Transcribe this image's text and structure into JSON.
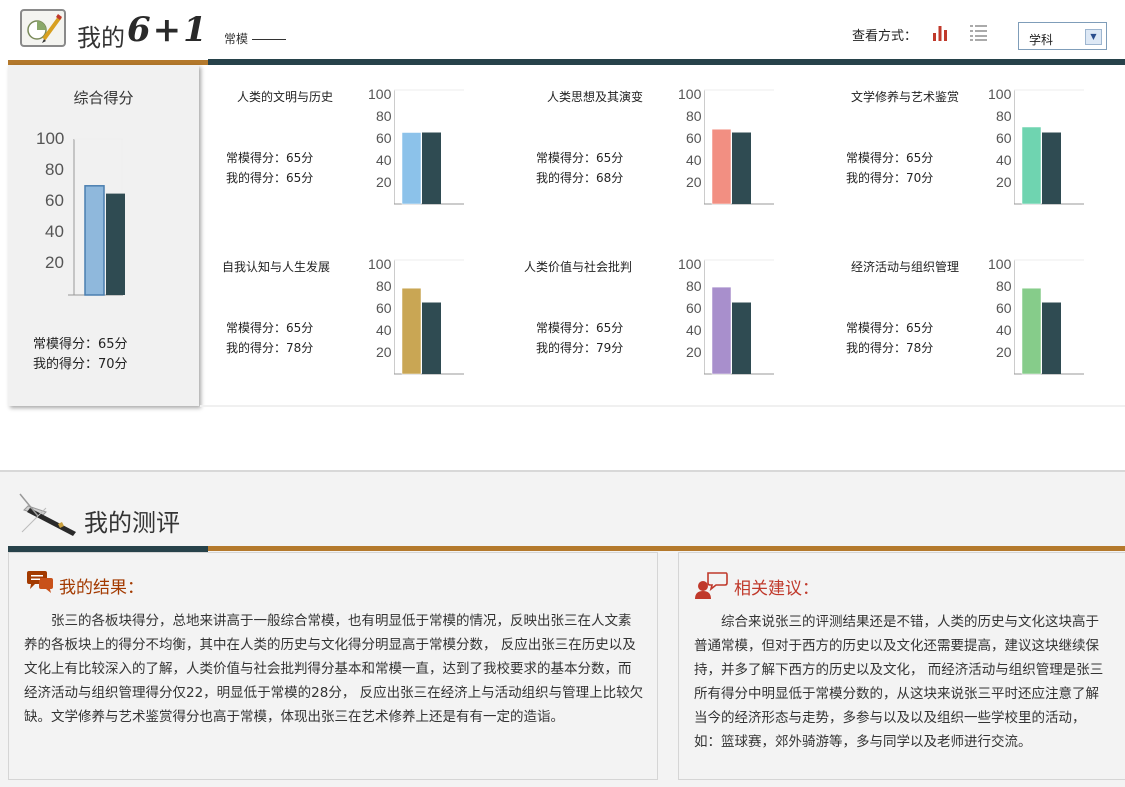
{
  "header": {
    "title_cn": "我的",
    "title_num": "6+1",
    "legend_label": "常模",
    "view_mode_label": "查看方式：",
    "subject_select_value": "学科"
  },
  "summary": {
    "title": "综合得分",
    "norm_score_text": "常模得分：65分",
    "my_score_text": "我的得分：70分",
    "ticks": [
      "100",
      "80",
      "60",
      "40",
      "20"
    ],
    "chart": {
      "my": 70,
      "norm": 65,
      "my_color": "#8fb8dc"
    }
  },
  "subjects": [
    {
      "title": "人类的文明与历史",
      "norm_text": "常模得分：65分",
      "my_text": "我的得分：65分",
      "my": 65,
      "norm": 65,
      "color": "#8cc2ea"
    },
    {
      "title": "人类思想及其演变",
      "norm_text": "常模得分：65分",
      "my_text": "我的得分：68分",
      "my": 68,
      "norm": 65,
      "color": "#f28f82"
    },
    {
      "title": "文学修养与艺术鉴赏",
      "norm_text": "常模得分：65分",
      "my_text": "我的得分：70分",
      "my": 70,
      "norm": 65,
      "color": "#6fd4b0"
    },
    {
      "title": "自我认知与人生发展",
      "norm_text": "常模得分：65分",
      "my_text": "我的得分：78分",
      "my": 78,
      "norm": 65,
      "color": "#c9a654"
    },
    {
      "title": "人类价值与社会批判",
      "norm_text": "常模得分：65分",
      "my_text": "我的得分：79分",
      "my": 79,
      "norm": 65,
      "color": "#a88fcc"
    },
    {
      "title": "经济活动与组织管理",
      "norm_text": "常模得分：65分",
      "my_text": "我的得分：78分",
      "my": 78,
      "norm": 65,
      "color": "#86cc8a"
    }
  ],
  "small_ticks": [
    "100",
    "80",
    "60",
    "40",
    "20"
  ],
  "norm_color": "#2f4b52",
  "evaluation": {
    "title": "我的测评",
    "result_heading": "我的结果：",
    "result_text": "张三的各板块得分，总地来讲高于一般综合常模，也有明显低于常模的情况，反映出张三在人文素养的各板块上的得分不均衡，其中在人类的历史与文化得分明显高于常模分数， 反应出张三在历史以及文化上有比较深入的了解，人类价值与社会批判得分基本和常模一直，达到了我校要求的基本分数，而经济活动与组织管理得分仅22，明显低于常模的28分， 反应出张三在经济上与活动组织与管理上比较欠缺。文学修养与艺术鉴赏得分也高于常模，体现出张三在艺术修养上还是有有一定的造诣。",
    "advice_heading": "相关建议：",
    "advice_text": "综合来说张三的评测结果还是不错，人类的历史与文化这块高于普通常模，但对于西方的历史以及文化还需要提高，建议这块继续保持，并多了解下西方的历史以及文化， 而经济活动与组织管理是张三所有得分中明显低于常模分数的，从这块来说张三平时还应注意了解当今的经济形态与走势，多参与以及以及组织一些学校里的活动， 如：篮球赛，郊外骑游等，多与同学以及老师进行交流。"
  },
  "colors": {
    "accent_dark": "#27424a",
    "accent_brown": "#b4792c",
    "heading_red": "#a33a00",
    "icon_red": "#c0392b"
  }
}
